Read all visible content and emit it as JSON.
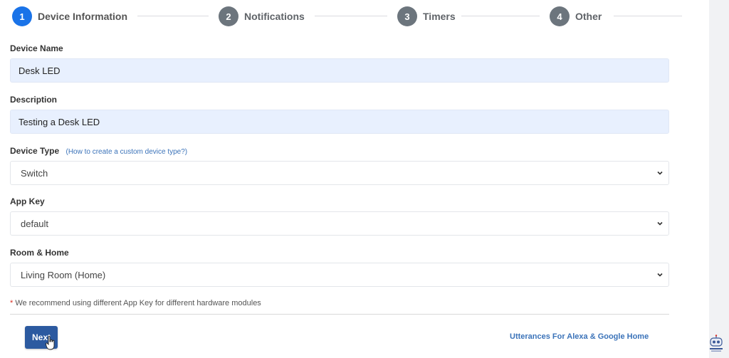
{
  "stepper": {
    "steps": [
      {
        "number": "1",
        "label": "Device Information",
        "active": true
      },
      {
        "number": "2",
        "label": "Notifications",
        "active": false
      },
      {
        "number": "3",
        "label": "Timers",
        "active": false
      },
      {
        "number": "4",
        "label": "Other",
        "active": false
      }
    ]
  },
  "form": {
    "device_name": {
      "label": "Device Name",
      "value": "Desk LED"
    },
    "description": {
      "label": "Description",
      "value": "Testing a Desk LED"
    },
    "device_type": {
      "label": "Device Type",
      "help_link": "(How to create a custom device type?)",
      "value": "Switch"
    },
    "app_key": {
      "label": "App Key",
      "value": "default"
    },
    "room_home": {
      "label": "Room & Home",
      "value": "Living Room (Home)"
    },
    "note_star": "*",
    "note": " We recommend using different App Key for different hardware modules"
  },
  "footer": {
    "next_label": "Next",
    "utterances_link": "Utterances For Alexa & Google Home"
  },
  "colors": {
    "accent": "#1a73e8",
    "button": "#2c5aa0",
    "input_fill": "#e8f0fe",
    "link": "#3b73b9",
    "step_inactive": "#6c757d"
  }
}
